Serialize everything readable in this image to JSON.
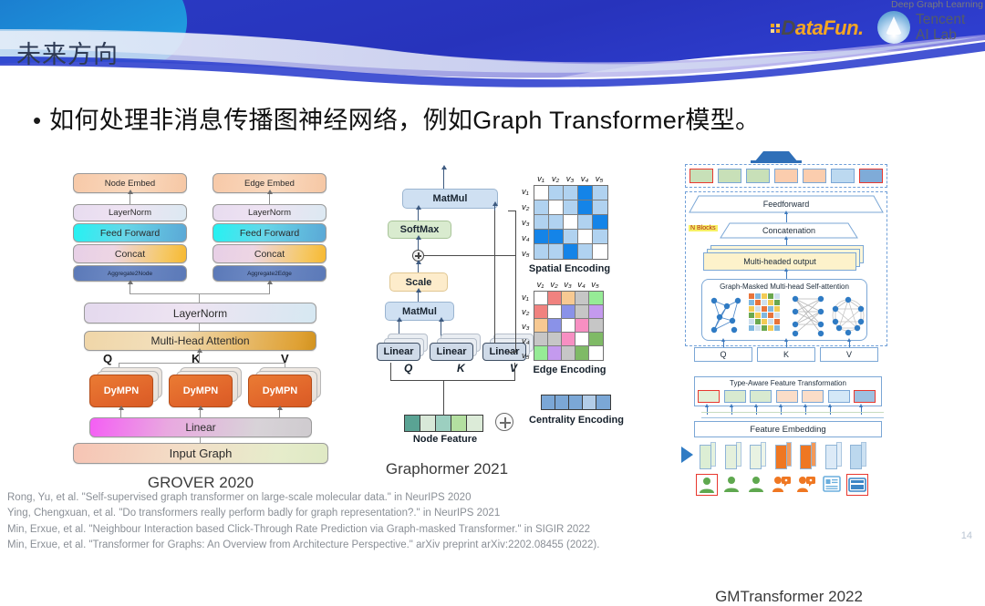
{
  "header": {
    "title": "未来方向",
    "dgl_caption": "Deep Graph Learning",
    "datafun_logo_d": "D",
    "datafun_logo_rest": "ataFun.",
    "tencent_line1": "Tencent",
    "tencent_line2": "AI Lab",
    "banner_colors": {
      "deep_blue": "#2433b8",
      "cyan": "#1f93d8",
      "violet": "#9b93e0",
      "pale": "#dfe7f5"
    }
  },
  "bullet": {
    "marker": "•",
    "text": "如何处理非消息传播图神经网络，例如Graph Transformer模型。"
  },
  "figures": [
    {
      "id": "grover",
      "caption": "GROVER 2020"
    },
    {
      "id": "graphormer",
      "caption": "Graphormer 2021"
    },
    {
      "id": "gmtransformer",
      "caption": "GMTransformer 2022"
    }
  ],
  "grover": {
    "node_embed": "Node Embed",
    "edge_embed": "Edge Embed",
    "layernorm_left": "LayerNorm",
    "layernorm_right": "LayerNorm",
    "feed_forward_left": "Feed Forward",
    "feed_forward_right": "Feed Forward",
    "concat_left": "Concat",
    "concat_right": "Concat",
    "aggregate2node": "Aggregate2Node",
    "aggregate2edge": "Aggregate2Edge",
    "layernorm_shared": "LayerNorm",
    "multi_head_attention": "Multi-Head Attention",
    "q_label": "Q",
    "k_label": "K",
    "v_label": "V",
    "dympn_1": "DyMPN",
    "dympn_2": "DyMPN",
    "dympn_3": "DyMPN",
    "linear": "Linear",
    "input_graph": "Input Graph"
  },
  "graphormer": {
    "matmul_top": "MatMul",
    "softmax": "SoftMax",
    "scale": "Scale",
    "matmul_bottom": "MatMul",
    "linear_q": "Linear",
    "linear_k": "Linear",
    "linear_v": "Linear",
    "q_label": "Q",
    "k_label": "K",
    "v_label": "V",
    "node_feature": "Node Feature",
    "spatial_encoding": "Spatial Encoding",
    "edge_encoding": "Edge Encoding",
    "centrality_encoding": "Centrality Encoding",
    "vertex_labels": [
      "v₁",
      "v₂",
      "v₃",
      "v₄",
      "v₅"
    ],
    "node_feature_colors": [
      "#5aa394",
      "#d8e8d8",
      "#9ccfc0",
      "#b3dfa0",
      "#dcebd8"
    ],
    "centrality_colors": [
      "#7ba7d6",
      "#7ba7d6",
      "#7ba7d6",
      "#b3cde8",
      "#7ba7d6"
    ],
    "spatial_matrix": [
      [
        "#ffffff",
        "#b0d2f0",
        "#b0d2f0",
        "#1484e8",
        "#b0d2f0"
      ],
      [
        "#b0d2f0",
        "#ffffff",
        "#b0d2f0",
        "#1484e8",
        "#b0d2f0"
      ],
      [
        "#b0d2f0",
        "#b0d2f0",
        "#ffffff",
        "#b0d2f0",
        "#1484e8"
      ],
      [
        "#1484e8",
        "#1484e8",
        "#b0d2f0",
        "#ffffff",
        "#b0d2f0"
      ],
      [
        "#b0d2f0",
        "#b0d2f0",
        "#1484e8",
        "#b0d2f0",
        "#ffffff"
      ]
    ],
    "edge_matrix": [
      [
        "#ffffff",
        "#f0827f",
        "#f7c992",
        "#c6c6c6",
        "#96eb96"
      ],
      [
        "#f0827f",
        "#ffffff",
        "#8a92e8",
        "#c6c6c6",
        "#c49aee"
      ],
      [
        "#f7c992",
        "#8a92e8",
        "#ffffff",
        "#f78fc2",
        "#c6c6c6"
      ],
      [
        "#c6c6c6",
        "#c6c6c6",
        "#f78fc2",
        "#ffffff",
        "#7fba66"
      ],
      [
        "#96eb96",
        "#c49aee",
        "#c6c6c6",
        "#7fba66",
        "#ffffff"
      ]
    ]
  },
  "gmtransformer": {
    "feedforward": "Feedforward",
    "concatenation": "Concatenation",
    "n_blocks": "N Blocks",
    "multi_headed_output": "Multi-headed output",
    "graph_masked_attention": "Graph-Masked Multi-head Self-attention",
    "q_label": "Q",
    "k_label": "K",
    "v_label": "V",
    "type_aware": "Type-Aware Feature Transformation",
    "feature_embedding": "Feature Embedding",
    "top_chip_colors": [
      "#c8e0b8",
      "#c8e0b8",
      "#c8e0b8",
      "#fbcdae",
      "#fbcdae",
      "#bcd9f0",
      "#7fabd8"
    ],
    "tat_chip_colors": [
      "#e2f0d8",
      "#d8ead0",
      "#d8ead0",
      "#fbddc8",
      "#fbddc8",
      "#d4e8f7",
      "#9dc0e0"
    ],
    "entity_icon_colors": [
      "#5fa84f",
      "#5fa84f",
      "#5fa84f",
      "#ef7722",
      "#ef7722",
      "#6aaedd",
      "#3d86c6"
    ]
  },
  "references": [
    "Rong, Yu, et al. \"Self-supervised graph transformer on large-scale molecular data.\" in NeurIPS 2020",
    "Ying, Chengxuan, et al. \"Do transformers really perform badly for graph representation?.\" in NeurIPS 2021",
    "Min, Erxue, et al. \"Neighbour Interaction based Click-Through Rate Prediction via Graph-masked Transformer.\" in SIGIR 2022",
    "Min, Erxue, et al. \"Transformer for Graphs: An Overview from Architecture Perspective.\" arXiv preprint arXiv:2202.08455 (2022)."
  ],
  "page_number": "14"
}
